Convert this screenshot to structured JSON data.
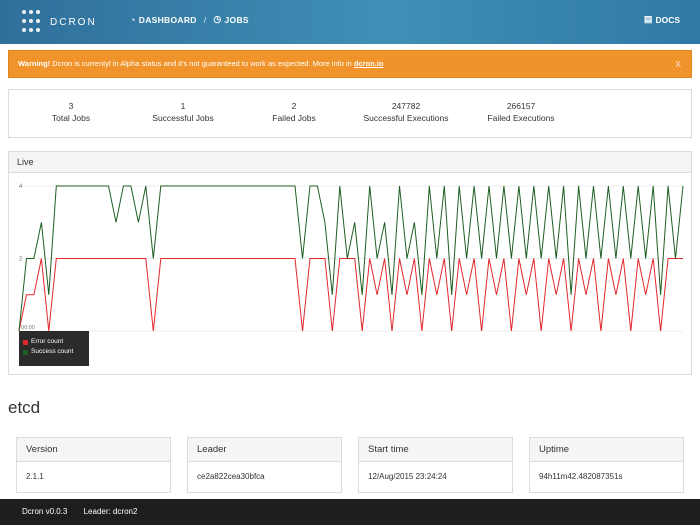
{
  "nav": {
    "brand": "DCRON",
    "dashboard_label": "DASHBOARD",
    "dashboard_icon": "dashboard-icon",
    "separator": "/",
    "jobs_label": "JOBS",
    "jobs_icon": "clock-icon",
    "docs_label": "DOCS",
    "docs_icon": "book-icon"
  },
  "alert": {
    "strong": "Warning!",
    "text": " Dcron is currentyl in Alpha status and it's not guaranteed to work as expected. More info in ",
    "link": "dcron.io",
    "close": "x",
    "color": "#f0932a"
  },
  "stats": [
    {
      "value": "3",
      "label": "Total Jobs"
    },
    {
      "value": "1",
      "label": "Successful Jobs"
    },
    {
      "value": "2",
      "label": "Failed Jobs"
    },
    {
      "value": "247782",
      "label": "Successful Executions"
    },
    {
      "value": "266157",
      "label": "Failed Executions"
    }
  ],
  "live": {
    "title": "Live",
    "chart_data": {
      "type": "line",
      "ylim": [
        0,
        4
      ],
      "yticks": [
        "4",
        "2"
      ],
      "x_start_label": "00:00",
      "legend_placement": "bottom-left",
      "series": [
        {
          "name": "Error count",
          "color": "#e3262b",
          "values": [
            0,
            1,
            1,
            2,
            0,
            2,
            2,
            2,
            2,
            2,
            2,
            2,
            2,
            2,
            2,
            2,
            2,
            2,
            0,
            2,
            2,
            2,
            2,
            2,
            2,
            2,
            2,
            2,
            2,
            2,
            2,
            2,
            2,
            2,
            2,
            2,
            2,
            2,
            0,
            2,
            2,
            2,
            0,
            2,
            2,
            2,
            0,
            2,
            1,
            2,
            0,
            2,
            1,
            2,
            0,
            2,
            1,
            2,
            0,
            2,
            1,
            2,
            0,
            2,
            1,
            2,
            0,
            2,
            1,
            2,
            0,
            2,
            1,
            2,
            0,
            2,
            1,
            2,
            0,
            2,
            1,
            2,
            0,
            2,
            1,
            2,
            0,
            2,
            2,
            2
          ]
        },
        {
          "name": "Success count",
          "color": "#1e5e21",
          "values": [
            0,
            2,
            2,
            3,
            1,
            4,
            4,
            4,
            4,
            4,
            4,
            4,
            4,
            3,
            4,
            4,
            3,
            4,
            2,
            4,
            4,
            4,
            4,
            4,
            4,
            4,
            4,
            4,
            4,
            4,
            4,
            4,
            4,
            4,
            4,
            4,
            4,
            4,
            2,
            4,
            4,
            3,
            1,
            4,
            2,
            3,
            1,
            4,
            2,
            3,
            1,
            4,
            2,
            3,
            1,
            4,
            2,
            4,
            1,
            4,
            2,
            4,
            2,
            4,
            2,
            4,
            2,
            4,
            2,
            4,
            2,
            4,
            2,
            4,
            1,
            4,
            2,
            4,
            2,
            4,
            2,
            4,
            2,
            4,
            2,
            4,
            1,
            4,
            2,
            4
          ]
        }
      ]
    }
  },
  "etcd": {
    "title": "etcd",
    "cards": [
      {
        "head": "Version",
        "value": "2.1.1"
      },
      {
        "head": "Leader",
        "value": "ce2a822cea30bfca"
      },
      {
        "head": "Start time",
        "value": "12/Aug/2015 23:24:24"
      },
      {
        "head": "Uptime",
        "value": "94h11m42.482087351s"
      }
    ]
  },
  "footer": {
    "version": "Dcron v0.0.3",
    "leader": "Leader: dcron2"
  }
}
